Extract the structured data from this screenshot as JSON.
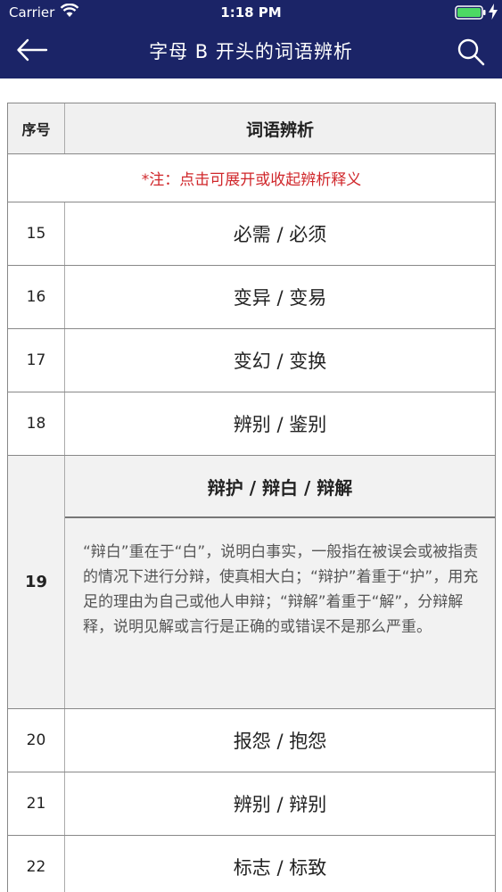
{
  "status": {
    "carrier": "Carrier",
    "time": "1:18 PM"
  },
  "nav": {
    "title": "字母 B 开头的词语辨析"
  },
  "table": {
    "col_num": "序号",
    "col_word": "词语辨析",
    "note": "*注：点击可展开或收起辨析释义",
    "rows": [
      {
        "num": "15",
        "words": "必需 / 必须"
      },
      {
        "num": "16",
        "words": "变异 / 变易"
      },
      {
        "num": "17",
        "words": "变幻 / 变换"
      },
      {
        "num": "18",
        "words": "辨别 / 鉴别"
      }
    ],
    "expanded": {
      "num": "19",
      "words": "辩护 / 辩白 / 辩解",
      "explanation": "“辩白”重在于“白”，说明白事实，一般指在被误会或被指责的情况下进行分辩，使真相大白；“辩护”着重于“护”，用充足的理由为自己或他人申辩；“辩解”着重于“解”，分辩解释，说明见解或言行是正确的或错误不是那么严重。"
    },
    "rows_after": [
      {
        "num": "20",
        "words": "报怨 / 抱怨"
      },
      {
        "num": "21",
        "words": "辨别 / 辩别"
      },
      {
        "num": "22",
        "words": "标志 / 标致"
      }
    ]
  }
}
